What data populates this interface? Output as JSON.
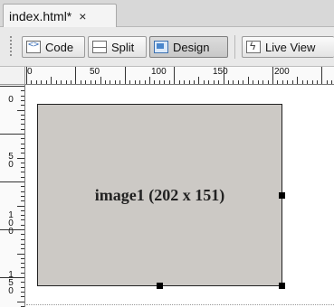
{
  "document_tab": {
    "label": "index.html*",
    "close_glyph": "×"
  },
  "toolbar": {
    "code_label": "Code",
    "split_label": "Split",
    "design_label": "Design",
    "live_view_label": "Live View",
    "active_view": "Design"
  },
  "ruler": {
    "horizontal_labels": [
      "0",
      "50",
      "100",
      "150",
      "200"
    ],
    "vertical_labels": [
      "0",
      "50",
      "100",
      "150"
    ],
    "units": "px"
  },
  "image_placeholder": {
    "label": "image1 (202 x 151)",
    "fill_color": "#ccc9c5"
  },
  "colors": {
    "tabstrip": "#d8d8d8",
    "toolbar": "#e9e9e9",
    "active_button": "#c8c8c8"
  }
}
